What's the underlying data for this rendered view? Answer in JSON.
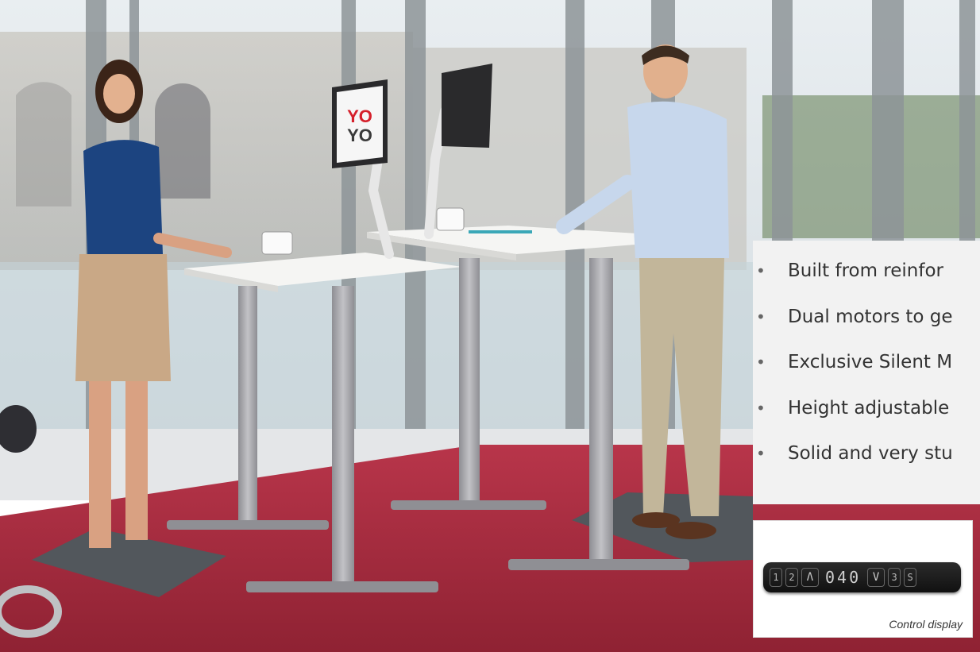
{
  "scene": {
    "brand_logo_line1": "YO",
    "brand_logo_line2": "YO",
    "colors": {
      "carpet": "#a52a3a",
      "desktop": "#f4f4f2",
      "frame": "#a8a8ac",
      "mat": "#555a5f"
    }
  },
  "features": [
    "Built from reinfor",
    "Dual motors to ge",
    "Exclusive Silent M",
    "Height adjustable",
    "Solid and very stu"
  ],
  "control_display": {
    "keys_left": [
      "1",
      "2"
    ],
    "up_arrow": "Λ",
    "height_readout": "040",
    "down_arrow": "V",
    "keys_right": [
      "3",
      "S"
    ],
    "caption": "Control display"
  }
}
